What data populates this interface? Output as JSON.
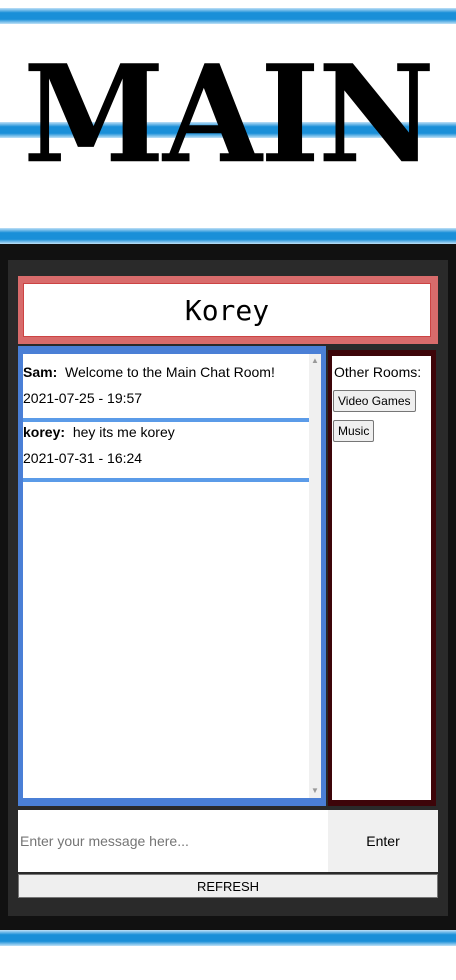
{
  "header": {
    "title": "MAIN"
  },
  "user": {
    "name": "Korey"
  },
  "messages": [
    {
      "user": "Sam:",
      "text": "Welcome to the Main Chat Room!",
      "timestamp": "2021-07-25 - 19:57"
    },
    {
      "user": "korey:",
      "text": "hey its me korey",
      "timestamp": "2021-07-31 - 16:24"
    }
  ],
  "rooms": {
    "label": "Other Rooms:",
    "items": [
      "Video Games",
      "Music"
    ]
  },
  "composer": {
    "placeholder": "Enter your message here...",
    "enter_label": "Enter",
    "refresh_label": "REFRESH"
  },
  "colors": {
    "stripe": "#1a8fd8",
    "user_border": "#d86b6b",
    "chat_border": "#4a7fd6",
    "rooms_border": "#3d0509"
  }
}
